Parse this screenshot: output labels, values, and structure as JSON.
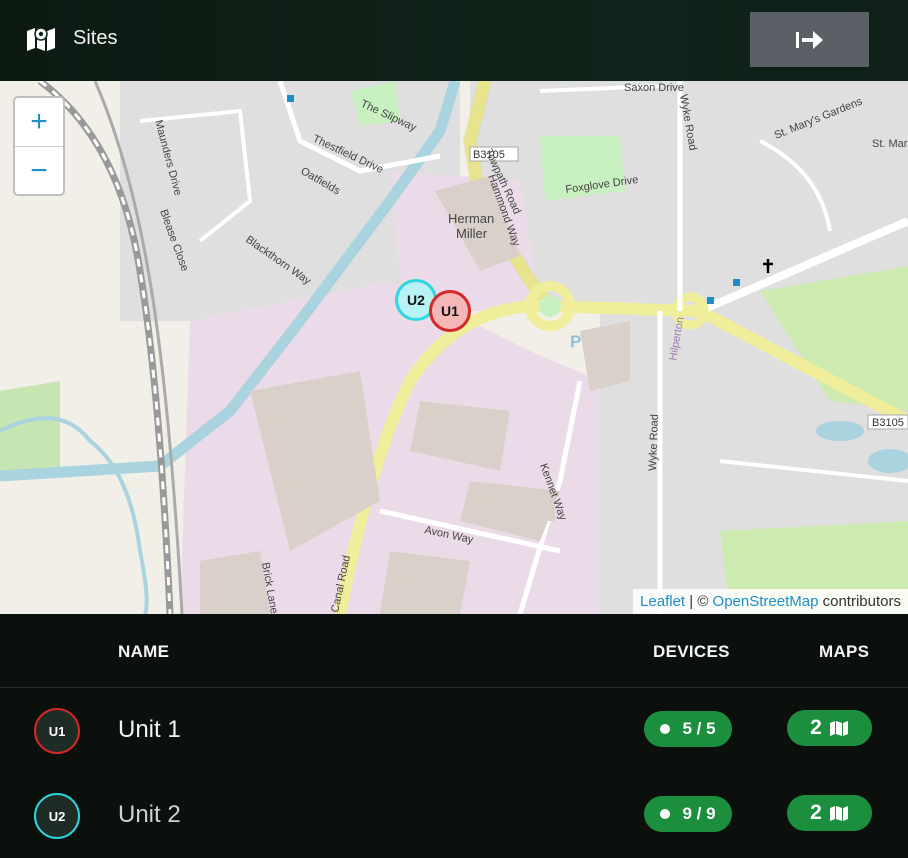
{
  "header": {
    "title": "Sites",
    "logout_icon": "logout-arrow-icon",
    "logo_icon": "map-icon"
  },
  "map": {
    "zoom_in": "+",
    "zoom_out": "−",
    "markers": [
      {
        "label": "U2",
        "border_color": "#2fd6e0",
        "fill_color": "#b9f2f5"
      },
      {
        "label": "U1",
        "border_color": "#d62828",
        "fill_color": "#f4b6b6"
      }
    ],
    "labels": {
      "herman": "Herman",
      "miller": "Miller",
      "b3105_a": "B3105",
      "b3105_b": "B3105",
      "slipway": "The Slipway",
      "thestfield": "Thestfield Drive",
      "oatfields": "Oatfields",
      "blackthorn": "Blackthorn Way",
      "maunders": "Maunders Drive",
      "blease": "Blease Close",
      "towpath": "Towpath Road",
      "hammond": "Hammond Way",
      "foxglove": "Foxglove Drive",
      "saxon": "Saxon Drive",
      "wyke_top": "Wyke Road",
      "wyke_bottom": "Wyke Road",
      "st_marys": "St. Mary's Gardens",
      "st_mar": "St. Mar",
      "hilperton": "Hilperton",
      "kennet": "Kennet Way",
      "avon": "Avon Way",
      "canal": "Canal Road",
      "brick": "Brick Lane",
      "parking": "P"
    },
    "attribution": {
      "leaflet": "Leaflet",
      "separator": " | © ",
      "osm": "OpenStreetMap",
      "suffix": " contributors"
    }
  },
  "table": {
    "headers": {
      "name": "NAME",
      "devices": "DEVICES",
      "maps": "MAPS"
    },
    "rows": [
      {
        "avatar": "U1",
        "avatar_border": "#d62828",
        "name": "Unit 1",
        "devices": "5 / 5",
        "maps": "2"
      },
      {
        "avatar": "U2",
        "avatar_border": "#2fd6e0",
        "name": "Unit 2",
        "devices": "9 / 9",
        "maps": "2"
      }
    ]
  },
  "colors": {
    "accent_green": "#1c8f3e",
    "header_bg": "#0f241a",
    "link_blue": "#1e8fc6"
  }
}
